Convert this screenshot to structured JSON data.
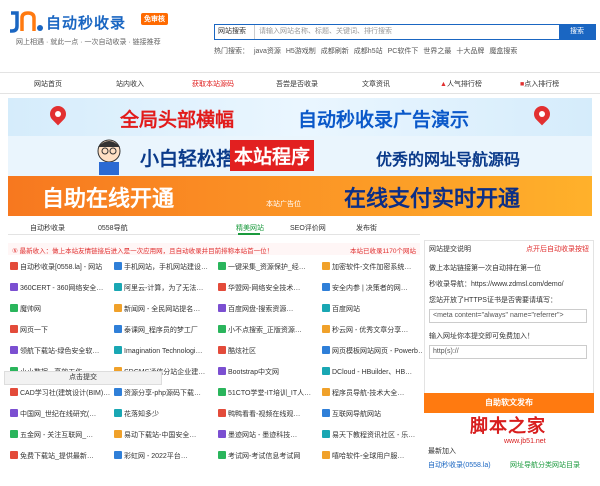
{
  "header": {
    "logo_text": "自动秒收录",
    "logo_badge": "免审核",
    "slogan": "网上相遇 · 就此一点 · 一次自动收录 · 链接推荐",
    "search_select": "网站搜索",
    "search_placeholder": "请输入网站名称、标题、关键词、排行搜索",
    "search_button": "搜索",
    "hot_label": "热门搜索：",
    "hot_terms": [
      "java资源",
      "H5游戏制",
      "成都刷新",
      "成都h5站",
      "PC软件下",
      "世界之最",
      "十大品牌",
      "魔盒搜索"
    ]
  },
  "nav": {
    "items": [
      "网站首页",
      "站内收入",
      "获取本站源码",
      "吾尝是否收录",
      "文章资讯",
      "人气排行榜",
      "点入排行榜"
    ],
    "active_index": 2
  },
  "banners": {
    "b1_red": "全局头部横幅",
    "b1_blue": "自动秒收录广告演示",
    "b2_a": "小白轻松搭建",
    "b2_b": "本站程序",
    "b2_c": "优秀的网址导航源码",
    "b3_a": "自助在线开通",
    "b3_mid": "本站广告位",
    "b3_b": "在线支付实时开通"
  },
  "tabs": {
    "items": [
      "自动秒收录",
      "0558导航",
      "精美网站",
      "SEO评价网",
      "发布街"
    ],
    "active_index": 2
  },
  "notice": {
    "left": "⑤ 最新收入：做上本站友情链接后进入是一次应用网，且自动收录并目前排称本站首一位！",
    "right": "本站已收录1170个网站"
  },
  "sites": [
    [
      "自动秒收录[0558.la] - 网站",
      "手机网站，手机网站建设…",
      "一键采集_资源保护_经…",
      "加密软件-文件加密系统…"
    ],
    [
      "360CERT - 360网络安全…",
      "阿里云-计算，为了无法…",
      "华盟网-网络安全技术…",
      "安全内参 | 决策者的网…"
    ],
    [
      "魔帅网",
      "新闻网 - 全民网站提名…",
      "百度网盘-搜索资源…",
      "百度网站"
    ],
    [
      "网页一下",
      "泰课网_程序员的梦工厂",
      "小不点搜索_正版资源…",
      "秒云网 - 优秀文章分享…"
    ],
    [
      "领航下载站-绿色安全软…",
      "Imagination Technologi…",
      "酷炫社区",
      "网页模板网站网页 - Powerb…"
    ],
    [
      "小小数据 - 高效工作，…",
      "SDCMS通信分站企业建…",
      "Bootstrap中文网",
      "DCloud - HBuilder、HB…"
    ],
    [
      "CAD学习社(建筑设计(BIM)…",
      "资源分享-php源码下载…",
      "51CTO学堂-IT培训_IT人…",
      "程序员导航-技术大全…"
    ],
    [
      "中国网_世纪在线研究(…",
      "花落知多少",
      "鸭鸭看看-视频在线观…",
      "互联网导航网站"
    ],
    [
      "五金网 - 关注互联网_…",
      "易动下载站-中国安全…",
      "墨迹网站 - 墨迹科技…",
      "易天下教程资讯社区 - 乐…"
    ],
    [
      "免费下载站_提供最新…",
      "彩虹网 - 2022平台…",
      "考试网-考试信息考试网",
      "嘻哈软件-全球用户服…"
    ]
  ],
  "right_panel": {
    "head": "网站提交说明",
    "more": "点开后自动收录按钮",
    "line1": "做上本站链接第一次自动排在第一位",
    "line2": "秒收录导航：https://www.zdmsl.com/demo/",
    "line3": "您站开放了HTTPS证书是否需要请填写：",
    "input1": "<meta content=\"always\" name=\"referrer\">",
    "line4": "输入网址你本提交即可免费加入！",
    "input2": "http(s)://",
    "submit": "点击提交",
    "publish": "自助软文发布"
  },
  "watermark": {
    "main": "脚本之家",
    "url": "www.jb51.net"
  },
  "recent": {
    "head": "最新加入",
    "a": "自动秒收录(0558.la)",
    "b": "网址导航分类网站目录"
  },
  "colors": {
    "brand": "#1a66c2",
    "accent": "#e21b1b",
    "green": "#1a9a3c",
    "orange": "#ff7a10"
  }
}
